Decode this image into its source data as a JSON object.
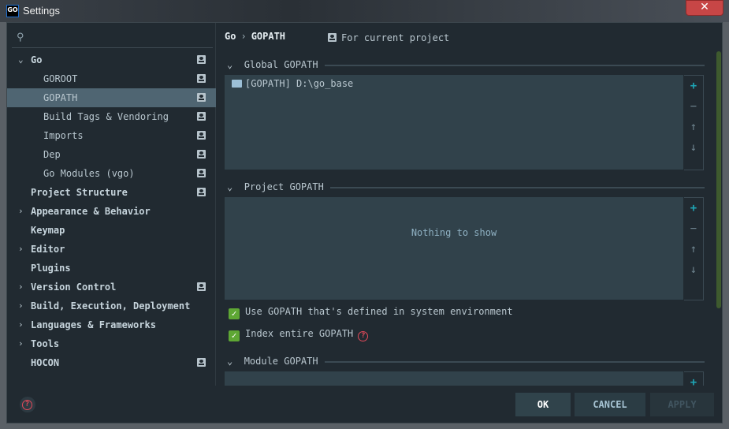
{
  "window": {
    "title": "Settings",
    "logo": "GO",
    "close": "✕"
  },
  "sidebar": {
    "search_icon": "⚲",
    "items": [
      {
        "label": "Go",
        "arrow": "⌄",
        "bold": true,
        "project": true
      },
      {
        "label": "GOROOT",
        "project": true
      },
      {
        "label": "GOPATH",
        "project": true,
        "selected": true
      },
      {
        "label": "Build Tags & Vendoring",
        "project": true
      },
      {
        "label": "Imports",
        "project": true
      },
      {
        "label": "Dep",
        "project": true
      },
      {
        "label": "Go Modules (vgo)",
        "project": true
      },
      {
        "label": "Project Structure",
        "bold": true,
        "project": true
      },
      {
        "label": "Appearance & Behavior",
        "arrow": "›",
        "bold": true
      },
      {
        "label": "Keymap",
        "bold": true
      },
      {
        "label": "Editor",
        "arrow": "›",
        "bold": true
      },
      {
        "label": "Plugins",
        "bold": true
      },
      {
        "label": "Version Control",
        "arrow": "›",
        "bold": true,
        "project": true
      },
      {
        "label": "Build, Execution, Deployment",
        "arrow": "›",
        "bold": true
      },
      {
        "label": "Languages & Frameworks",
        "arrow": "›",
        "bold": true
      },
      {
        "label": "Tools",
        "arrow": "›",
        "bold": true
      },
      {
        "label": "HOCON",
        "bold": true,
        "project": true
      }
    ]
  },
  "content": {
    "breadcrumb": {
      "parent": "Go",
      "sep": "›",
      "current": "GOPATH"
    },
    "for_project": "For current project",
    "global": {
      "title": "Global GOPATH",
      "entries": [
        "[GOPATH] D:\\go_base"
      ]
    },
    "project": {
      "title": "Project GOPATH",
      "empty": "Nothing to show"
    },
    "use_system": {
      "label": "Use GOPATH that's defined in system environment",
      "checked": true
    },
    "index_entire": {
      "label": "Index entire GOPATH",
      "checked": true
    },
    "module": {
      "title": "Module GOPATH"
    },
    "tools": {
      "add": "+",
      "remove": "−",
      "up": "↑",
      "down": "↓"
    },
    "chevron": "⌄"
  },
  "footer": {
    "ok": "OK",
    "cancel": "CANCEL",
    "apply": "APPLY",
    "help": "?"
  }
}
